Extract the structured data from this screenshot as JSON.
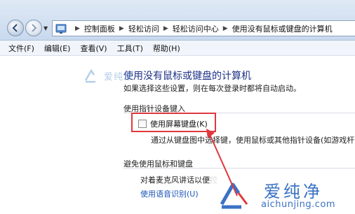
{
  "breadcrumb": {
    "items": [
      "控制面板",
      "轻松访问",
      "轻松访问中心",
      "使用没有鼠标或键盘的计算机"
    ]
  },
  "menu": {
    "items": [
      "文件(F)",
      "编辑(E)",
      "查看(V)",
      "工具(T)",
      "帮助(H)"
    ]
  },
  "content": {
    "title": "使用没有鼠标或键盘的计算机",
    "description": "如果选择这些设置，则在每次登录时都将自动启动。",
    "section1": {
      "heading": "使用指针设备键入",
      "checkbox_label": "使用屏幕键盘(K)",
      "checkbox_checked": false,
      "option_description": "通过从键盘图中选择键，使用鼠标或其他指针设备(如游戏杆"
    },
    "section2": {
      "heading": "避免使用鼠标和键盘",
      "option_description": "对着麦克风讲话以便控",
      "link": "使用语音识别(U)"
    }
  },
  "watermark": {
    "brand": "爱纯净",
    "url": "aichunjing.com"
  },
  "colors": {
    "title": "#1e3287",
    "link": "#1a54b8",
    "highlight": "#e0383e",
    "watermark": "#3a72c4"
  }
}
